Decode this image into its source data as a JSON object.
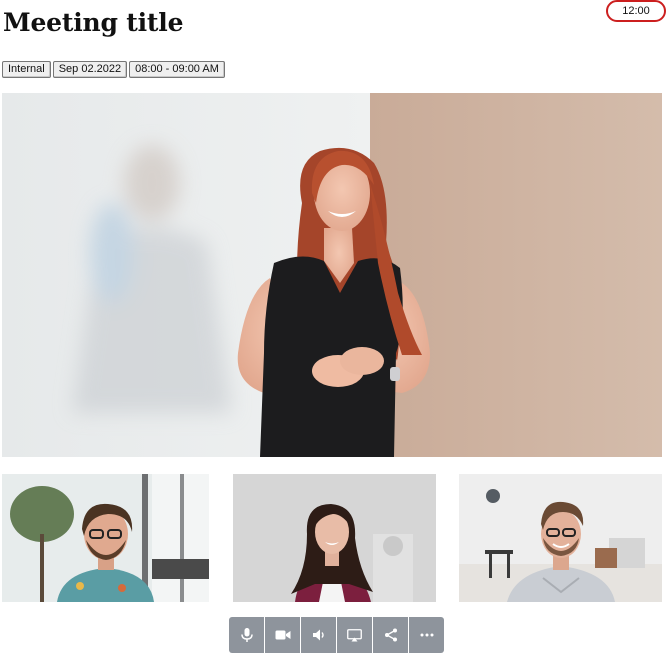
{
  "header": {
    "title": "Meeting title",
    "timer": "12:00"
  },
  "tags": [
    {
      "label": "Internal"
    },
    {
      "label": "Sep 02.2022"
    },
    {
      "label": "08:00 - 09:00 AM"
    }
  ],
  "timer_color": "#cc1f1f",
  "controls": [
    {
      "icon": "microphone-icon"
    },
    {
      "icon": "video-camera-icon"
    },
    {
      "icon": "speaker-icon"
    },
    {
      "icon": "screen-share-icon"
    },
    {
      "icon": "share-icon"
    },
    {
      "icon": "more-options-icon"
    }
  ],
  "control_color": "#8e949c"
}
